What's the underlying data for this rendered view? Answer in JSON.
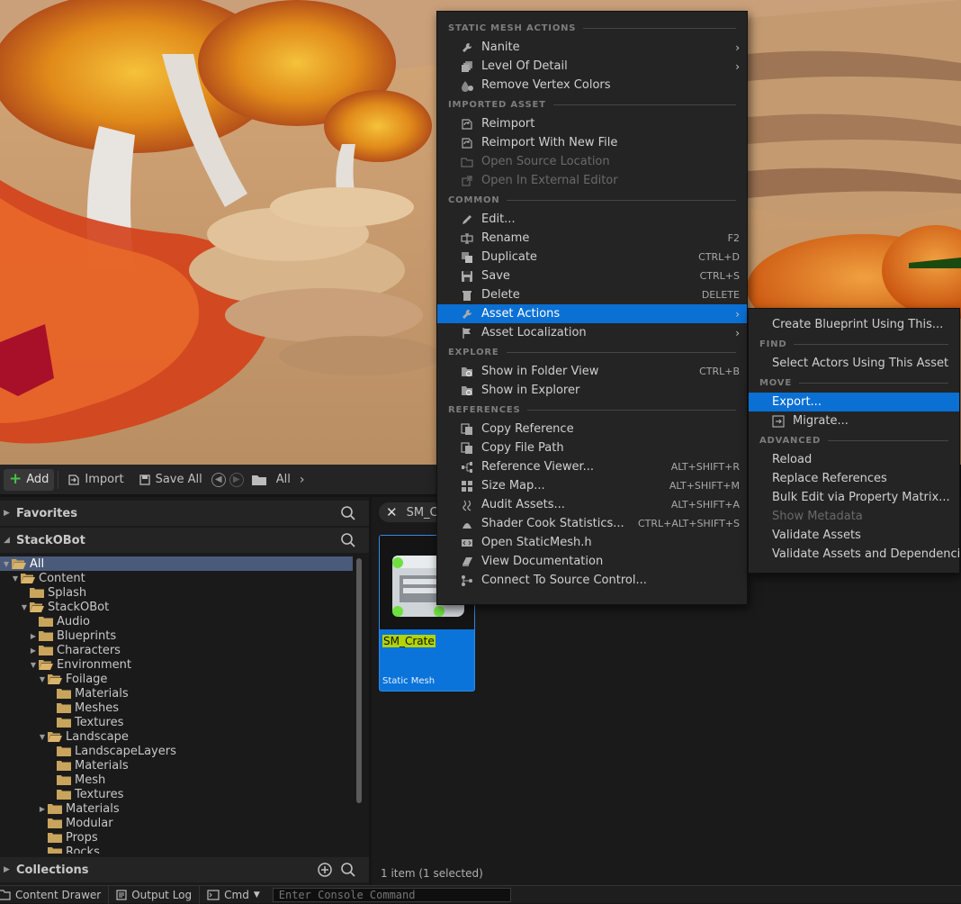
{
  "toolbar": {
    "add_label": "Add",
    "import_label": "Import",
    "save_all_label": "Save All",
    "path_label": "All"
  },
  "left_panel": {
    "favorites_label": "Favorites",
    "root_label": "StackOBot",
    "collections_label": "Collections",
    "tree": [
      {
        "label": "All",
        "level": 0,
        "expander": "down",
        "selected": true
      },
      {
        "label": "Content",
        "level": 1,
        "expander": "down"
      },
      {
        "label": "Splash",
        "level": 2,
        "expander": ""
      },
      {
        "label": "StackOBot",
        "level": 2,
        "expander": "down"
      },
      {
        "label": "Audio",
        "level": 3,
        "expander": ""
      },
      {
        "label": "Blueprints",
        "level": 3,
        "expander": "right"
      },
      {
        "label": "Characters",
        "level": 3,
        "expander": "right"
      },
      {
        "label": "Environment",
        "level": 3,
        "expander": "down"
      },
      {
        "label": "Foilage",
        "level": 4,
        "expander": "down"
      },
      {
        "label": "Materials",
        "level": 5,
        "expander": ""
      },
      {
        "label": "Meshes",
        "level": 5,
        "expander": ""
      },
      {
        "label": "Textures",
        "level": 5,
        "expander": ""
      },
      {
        "label": "Landscape",
        "level": 4,
        "expander": "down"
      },
      {
        "label": "LandscapeLayers",
        "level": 5,
        "expander": ""
      },
      {
        "label": "Materials",
        "level": 5,
        "expander": ""
      },
      {
        "label": "Mesh",
        "level": 5,
        "expander": ""
      },
      {
        "label": "Textures",
        "level": 5,
        "expander": ""
      },
      {
        "label": "Materials",
        "level": 4,
        "expander": "right"
      },
      {
        "label": "Modular",
        "level": 4,
        "expander": ""
      },
      {
        "label": "Props",
        "level": 4,
        "expander": ""
      },
      {
        "label": "Rocks",
        "level": 4,
        "expander": ""
      }
    ]
  },
  "content": {
    "path_chip": "SM_C",
    "asset_name": "SM_Crate",
    "asset_type": "Static Mesh",
    "status": "1 item (1 selected)"
  },
  "bottom_bar": {
    "content_drawer": "Content Drawer",
    "output_log": "Output Log",
    "cmd": "Cmd",
    "console_placeholder": "Enter Console Command"
  },
  "context_menu": {
    "sections": [
      {
        "header": "STATIC MESH ACTIONS",
        "items": [
          {
            "label": "Nanite",
            "icon": "wrench-icon",
            "submenu": true
          },
          {
            "label": "Level Of Detail",
            "icon": "lod-icon",
            "submenu": true
          },
          {
            "label": "Remove Vertex Colors",
            "icon": "paint-drop-icon"
          }
        ]
      },
      {
        "header": "IMPORTED ASSET",
        "items": [
          {
            "label": "Reimport",
            "icon": "reimport-icon"
          },
          {
            "label": "Reimport With New File",
            "icon": "reimport-icon"
          },
          {
            "label": "Open Source Location",
            "icon": "folder-open-icon",
            "disabled": true
          },
          {
            "label": "Open In External Editor",
            "icon": "external-icon",
            "disabled": true
          }
        ]
      },
      {
        "header": "COMMON",
        "items": [
          {
            "label": "Edit...",
            "icon": "pencil-icon"
          },
          {
            "label": "Rename",
            "icon": "rename-icon",
            "shortcut": "F2"
          },
          {
            "label": "Duplicate",
            "icon": "duplicate-icon",
            "shortcut": "CTRL+D"
          },
          {
            "label": "Save",
            "icon": "save-icon",
            "shortcut": "CTRL+S"
          },
          {
            "label": "Delete",
            "icon": "trash-icon",
            "shortcut": "DELETE"
          },
          {
            "label": "Asset Actions",
            "icon": "wrench-icon",
            "submenu": true,
            "highlighted": true
          },
          {
            "label": "Asset Localization",
            "icon": "flag-icon",
            "submenu": true
          }
        ]
      },
      {
        "header": "EXPLORE",
        "items": [
          {
            "label": "Show in Folder View",
            "icon": "folder-search-icon",
            "shortcut": "CTRL+B"
          },
          {
            "label": "Show in Explorer",
            "icon": "folder-search-icon"
          }
        ]
      },
      {
        "header": "REFERENCES",
        "items": [
          {
            "label": "Copy Reference",
            "icon": "copy-icon"
          },
          {
            "label": "Copy File Path",
            "icon": "copy-icon"
          },
          {
            "label": "Reference Viewer...",
            "icon": "graph-icon",
            "shortcut": "ALT+SHIFT+R"
          },
          {
            "label": "Size Map...",
            "icon": "grid-icon",
            "shortcut": "ALT+SHIFT+M"
          },
          {
            "label": "Audit Assets...",
            "icon": "audit-icon",
            "shortcut": "ALT+SHIFT+A"
          },
          {
            "label": "Shader Cook Statistics...",
            "icon": "shader-icon",
            "shortcut": "CTRL+ALT+SHIFT+S"
          },
          {
            "label": "Open StaticMesh.h",
            "icon": "code-icon"
          },
          {
            "label": "View Documentation",
            "icon": "book-icon"
          },
          {
            "label": "Connect To Source Control...",
            "icon": "source-control-icon"
          }
        ]
      }
    ]
  },
  "submenu": {
    "sections": [
      {
        "header": "",
        "items": [
          {
            "label": "Create Blueprint Using This..."
          }
        ]
      },
      {
        "header": "FIND",
        "items": [
          {
            "label": "Select Actors Using This Asset"
          }
        ]
      },
      {
        "header": "MOVE",
        "items": [
          {
            "label": "Export...",
            "highlighted": true
          },
          {
            "label": "Migrate...",
            "icon": "migrate-icon"
          }
        ]
      },
      {
        "header": "ADVANCED",
        "items": [
          {
            "label": "Reload"
          },
          {
            "label": "Replace References"
          },
          {
            "label": "Bulk Edit via Property Matrix..."
          },
          {
            "label": "Show Metadata",
            "disabled": true
          },
          {
            "label": "Validate Assets"
          },
          {
            "label": "Validate Assets and Dependencies"
          }
        ]
      }
    ]
  },
  "colors": {
    "highlight": "#0a70d4",
    "asset_tile": "#0a74da",
    "add_plus": "#49c14a",
    "folder": "#c9a45c"
  }
}
